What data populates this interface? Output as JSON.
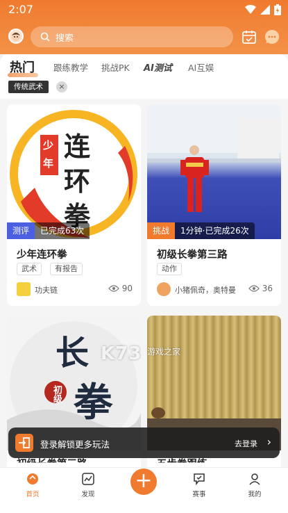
{
  "status_bar": {
    "time": "2:07"
  },
  "search": {
    "placeholder": "搜索"
  },
  "tabs": [
    {
      "label": "热门"
    },
    {
      "label": "跟练教学"
    },
    {
      "label": "挑战PK"
    },
    {
      "label": "AI测试"
    },
    {
      "label": "AI互娱"
    }
  ],
  "filter": {
    "chip": "传统武术",
    "close": "×"
  },
  "cards": [
    {
      "thumb_text_1": "少",
      "thumb_text_2": "年",
      "thumb_big_1": "连",
      "thumb_big_2": "环",
      "thumb_big_3": "拳",
      "badge_kind": "测评",
      "badge_value": "已完成63次",
      "title": "少年连环拳",
      "tags": [
        "武术",
        "有报告"
      ],
      "author": "功夫链",
      "views": "90",
      "badge_color": "#4b5fe0"
    },
    {
      "badge_kind": "挑战",
      "badge_value": "1分钟·已完成26次",
      "title": "初级长拳第三路",
      "tags": [
        "动作"
      ],
      "author": "小猪佩奇，奥特曼",
      "views": "36",
      "badge_color": "#f07a2e"
    },
    {
      "thumb_big_1": "长",
      "thumb_big_2": "拳",
      "thumb_small": "初级",
      "title": "初级长拳第三路"
    },
    {
      "title": "五步拳跟练"
    }
  ],
  "watermark": {
    "main": "K73",
    "sub": "游戏之家"
  },
  "banner": {
    "text": "登录解锁更多玩法",
    "link": "去登录",
    "arrow": "›"
  },
  "nav": [
    {
      "label": "首页"
    },
    {
      "label": "发现"
    },
    {
      "label": "+"
    },
    {
      "label": "赛事"
    },
    {
      "label": "我的"
    }
  ],
  "colors": {
    "accent": "#f07a2e",
    "assess_badge": "#4b5fe0"
  }
}
